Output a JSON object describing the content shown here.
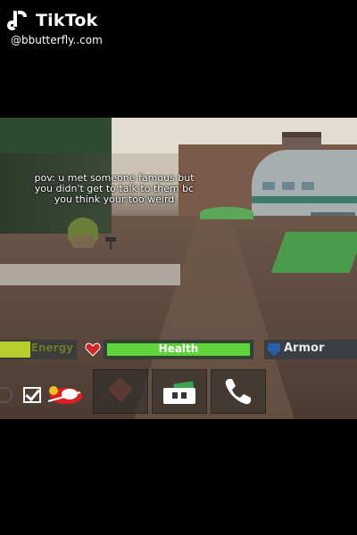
{
  "app": {
    "name": "TikTok",
    "handle": "@bbutterfly..com"
  },
  "caption": {
    "line1": "pov: u met someone famous but",
    "line2": "you didn't get to talk to them bc",
    "line3": "you think your too weird"
  },
  "hud": {
    "energy": {
      "label": "Energy",
      "level": 0.4,
      "color": "#b7cf2d"
    },
    "health": {
      "label": "Health",
      "level": 1.0,
      "color": "#5fd43d"
    },
    "armor": {
      "label": "Armor"
    }
  },
  "hotbar": {
    "icons": [
      "settings-icon",
      "checkbox-icon",
      "emote-icon",
      "tool-icon",
      "wallet-icon",
      "phone-icon"
    ]
  }
}
